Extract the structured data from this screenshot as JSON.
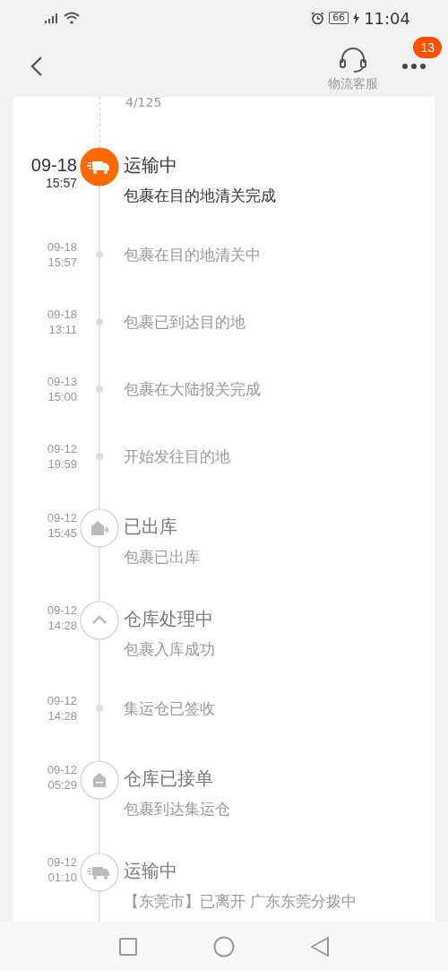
{
  "status_bar": {
    "battery": "66",
    "time": "11:04"
  },
  "header": {
    "service_label": "物流客服",
    "badge": "13"
  },
  "top_fragment": "4/125",
  "events": [
    {
      "kind": "transit",
      "active": true,
      "date": "09-18",
      "time": "15:57",
      "title": "运输中",
      "description": "包裹在目的地清关完成"
    },
    {
      "kind": "update",
      "active": false,
      "date": "09-18",
      "time": "15:57",
      "description": "包裹在目的地清关中"
    },
    {
      "kind": "update",
      "active": false,
      "date": "09-18",
      "time": "13:11",
      "description": "包裹已到达目的地"
    },
    {
      "kind": "update",
      "active": false,
      "date": "09-13",
      "time": "15:00",
      "description": "包裹在大陆报关完成"
    },
    {
      "kind": "update",
      "active": false,
      "date": "09-12",
      "time": "19:59",
      "description": "开始发往目的地"
    },
    {
      "kind": "outbound",
      "active": false,
      "date": "09-12",
      "time": "15:45",
      "title": "已出库",
      "description": "包裹已出库"
    },
    {
      "kind": "processing",
      "active": false,
      "date": "09-12",
      "time": "14:28",
      "title": "仓库处理中",
      "description": "包裹入库成功"
    },
    {
      "kind": "update",
      "active": false,
      "date": "09-12",
      "time": "14:28",
      "description": "集运仓已签收"
    },
    {
      "kind": "accepted",
      "active": false,
      "date": "09-12",
      "time": "05:29",
      "title": "仓库已接单",
      "description": "包裹到达集运仓"
    },
    {
      "kind": "transit",
      "active": false,
      "date": "09-12",
      "time": "01:10",
      "title": "运输中",
      "description": "【东莞市】已离开 广东东莞分拨中"
    }
  ]
}
